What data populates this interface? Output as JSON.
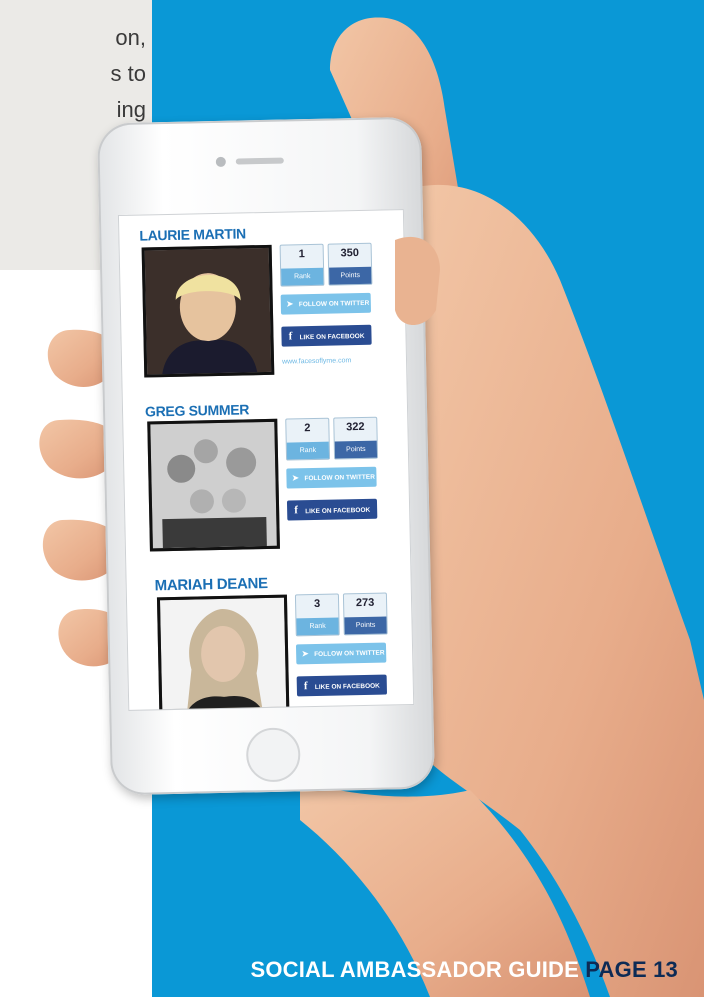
{
  "intro_fragment": {
    "lines": [
      "on,",
      "s to",
      "ing"
    ]
  },
  "profiles": [
    {
      "name": "LAURIE MARTIN",
      "rank": "1",
      "rank_label": "Rank",
      "points": "350",
      "points_label": "Points",
      "twitter_label": "FOLLOW ON TWITTER",
      "facebook_label": "LIKE ON FACEBOOK",
      "website": "www.facesoflyme.com"
    },
    {
      "name": "GREG SUMMER",
      "rank": "2",
      "rank_label": "Rank",
      "points": "322",
      "points_label": "Points",
      "twitter_label": "FOLLOW ON TWITTER",
      "facebook_label": "LIKE ON FACEBOOK"
    },
    {
      "name": "MARIAH DEANE",
      "rank": "3",
      "rank_label": "Rank",
      "points": "273",
      "points_label": "Points",
      "twitter_label": "FOLLOW ON TWITTER",
      "facebook_label": "LIKE ON FACEBOOK"
    }
  ],
  "footer": {
    "title": "SOCIAL AMBASSADOR GUIDE",
    "page": "PAGE 13"
  },
  "colors": {
    "blue_panel": "#0a98d6",
    "gray_panel": "#ebeae7",
    "name_blue": "#1b6fb4",
    "twitter": "#7cc3ea",
    "facebook": "#2a4c92"
  }
}
